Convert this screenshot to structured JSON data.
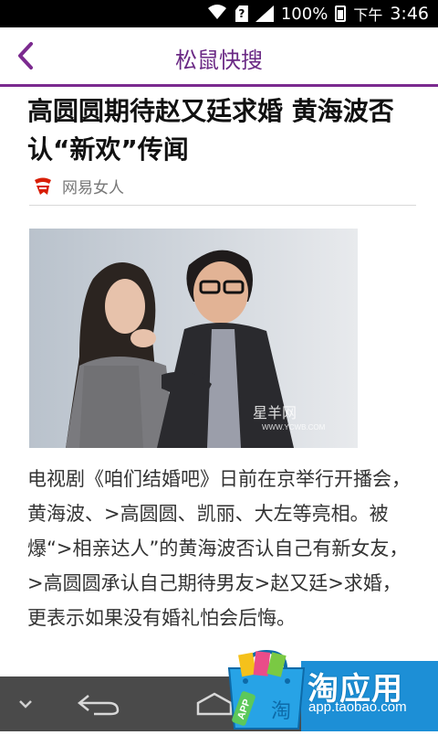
{
  "status": {
    "battery": "100%",
    "ampm": "下午",
    "time": "3:46",
    "sim_label": "?"
  },
  "app": {
    "title": "松鼠快搜"
  },
  "article": {
    "headline": "高圆圆期待赵又廷求婚 黄海波否认“新欢”传闻",
    "source": "网易女人",
    "body": "电视剧《咱们结婚吧》日前在京举行开播会，黄海波、>高圆圆、凯丽、大左等亮相。被爆“>相亲达人”的黄海波否认自己有新女友，>高圆圆承认自己期待男友>赵又廷>求婚，更表示如果没有婚礼怕会后悔。",
    "photo_watermark": "星羊网",
    "photo_watermark_url": "WWW.YCWB.COM"
  },
  "ad": {
    "brand": "淘应用",
    "url": "app.taobao.com",
    "badge": "APP",
    "side": "淘"
  },
  "icons": {
    "back": "back-arrow-icon",
    "wifi": "wifi-icon",
    "sim": "sim-icon",
    "signal": "signal-icon",
    "battery": "battery-icon",
    "hide_keyboard": "chevron-down-icon",
    "nav_back": "nav-back-icon",
    "home": "home-icon"
  },
  "colors": {
    "accent": "#6b2a85",
    "navbar": "#4a4a4a",
    "ad_blue": "#1d8fd6"
  }
}
